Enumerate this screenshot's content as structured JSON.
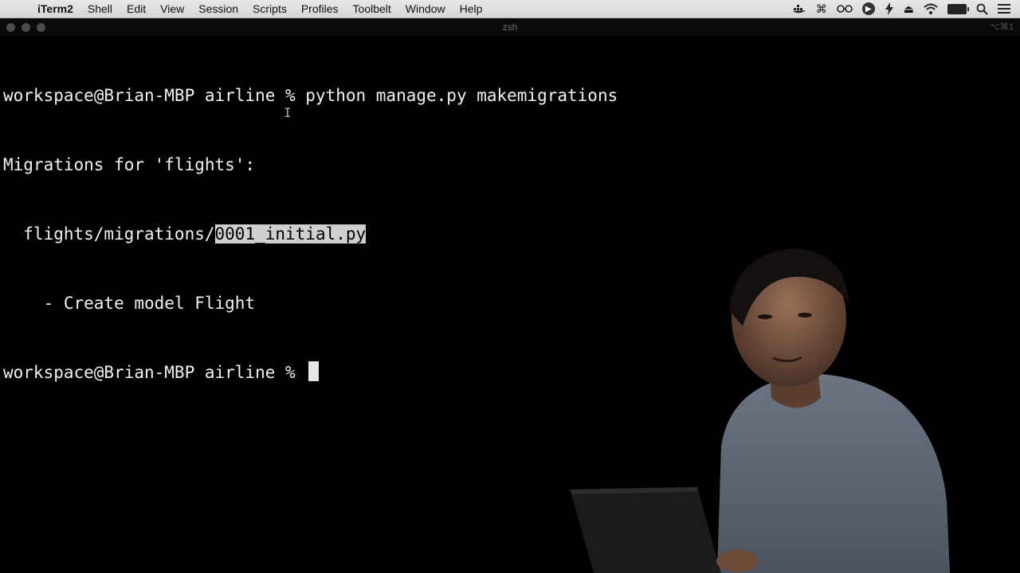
{
  "menubar": {
    "apple_icon": "apple-icon",
    "items": [
      "iTerm2",
      "Shell",
      "Edit",
      "View",
      "Session",
      "Scripts",
      "Profiles",
      "Toolbelt",
      "Window",
      "Help"
    ],
    "status_icons": [
      "docker-icon",
      "command-icon",
      "glasses-icon",
      "play-circle-icon",
      "bolt-icon",
      "eject-icon",
      "wifi-icon",
      "battery-icon",
      "search-icon",
      "menu-icon"
    ]
  },
  "window": {
    "title": "zsh",
    "shortcut": "⌥⌘1"
  },
  "terminal": {
    "lines": [
      {
        "text": "workspace@Brian-MBP airline % python manage.py makemigrations"
      },
      {
        "text": "Migrations for 'flights':"
      },
      {
        "prefix": "  flights/migrations/",
        "selected": "0001_initial.py"
      },
      {
        "text": "    - Create model Flight"
      },
      {
        "prompt": "workspace@Brian-MBP airline % "
      }
    ]
  }
}
